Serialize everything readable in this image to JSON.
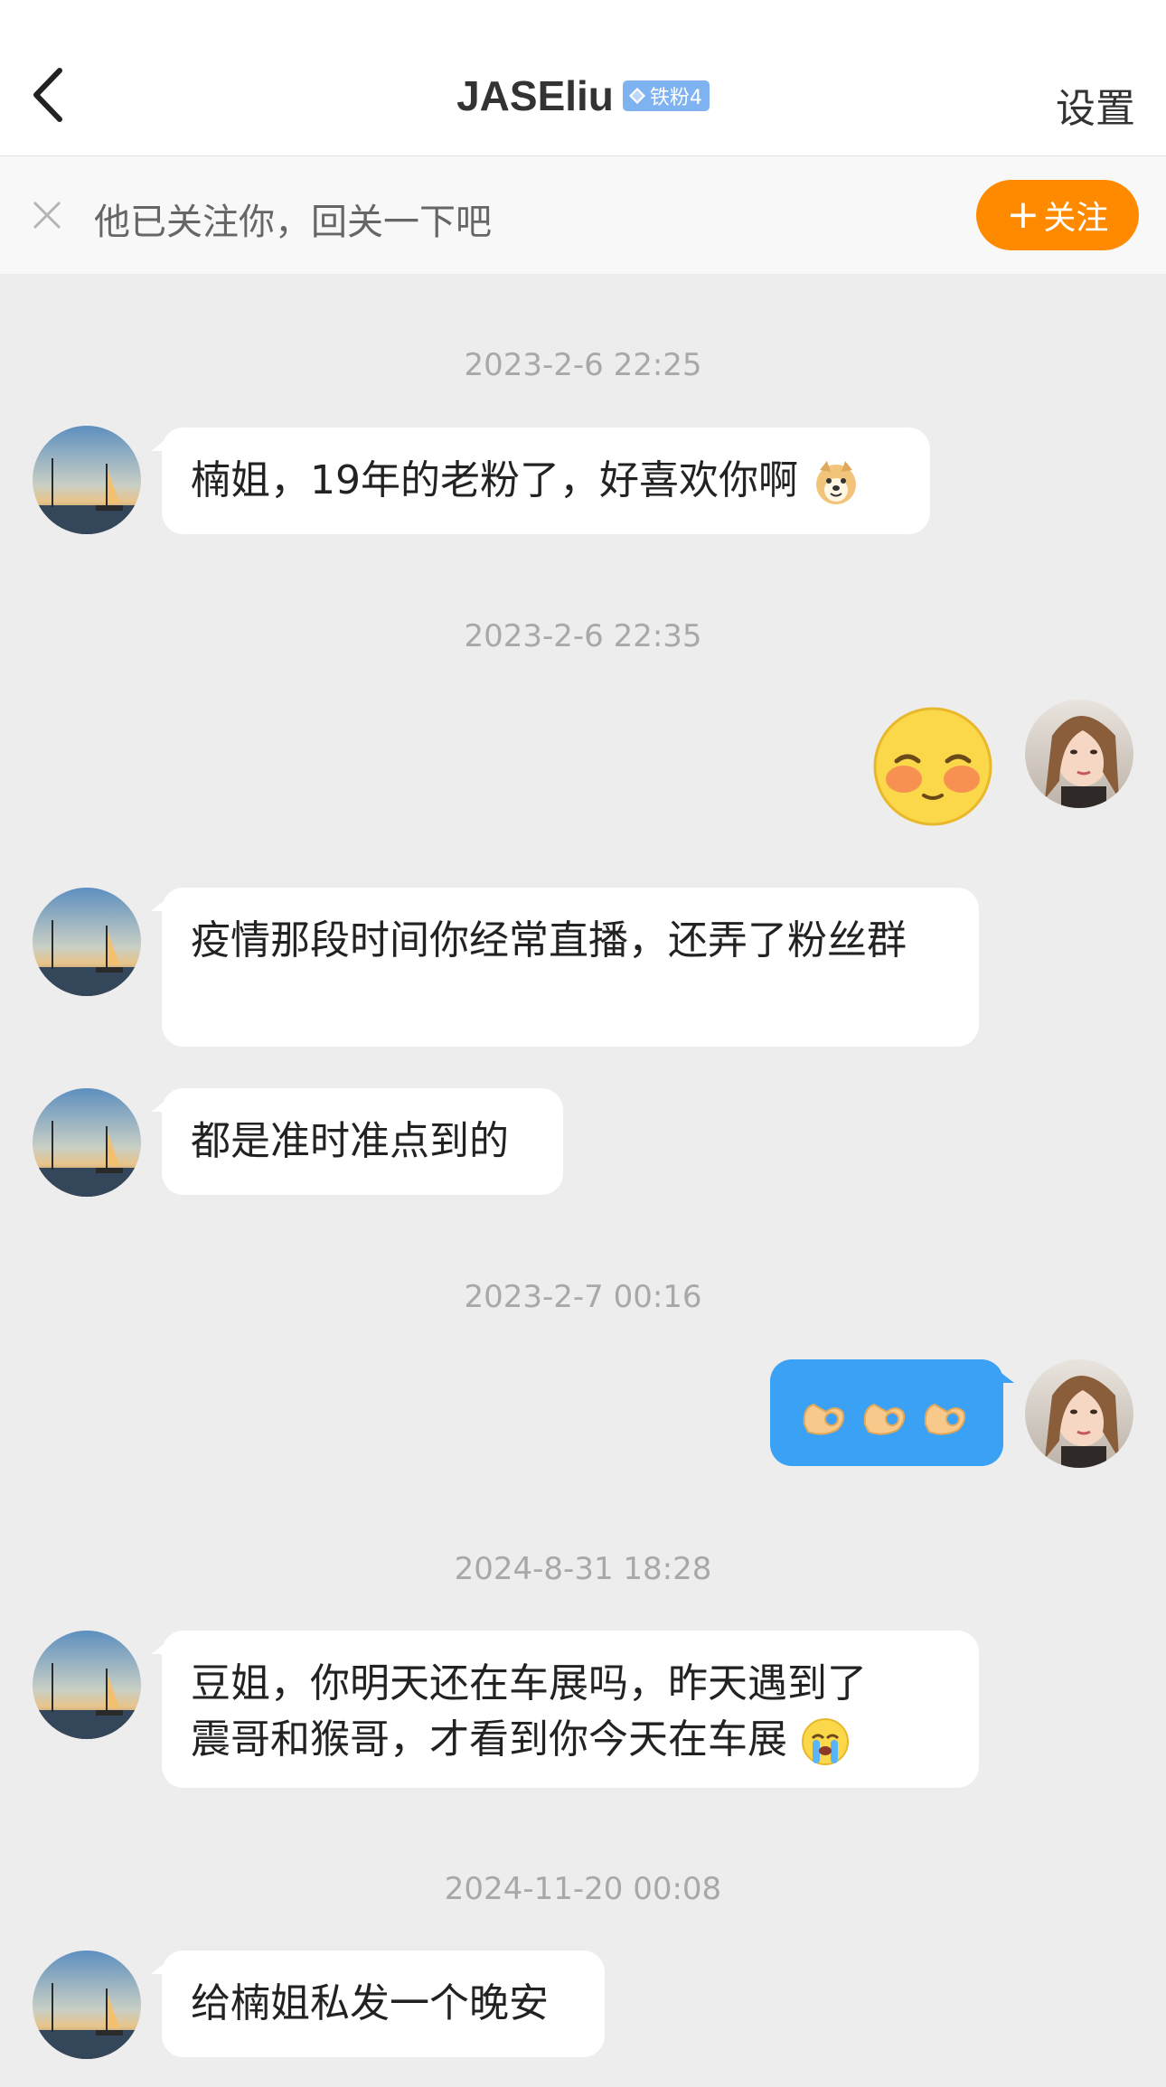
{
  "header": {
    "title": "JASEliu",
    "badge_label": "铁粉4",
    "settings_label": "设置"
  },
  "follow_prompt": {
    "text": "他已关注你，回关一下吧",
    "button_label": "关注"
  },
  "messages": [
    {
      "timestamp": "2023-2-6 22:25",
      "text": "楠姐，19年的老粉了，好喜欢你啊",
      "trailing_emoji": "doge-emoji"
    },
    {
      "timestamp": "2023-2-6 22:35",
      "sticker": "shy-blush-emoji"
    },
    {
      "text": "疫情那段时间你经常直播，还弄了粉丝群"
    },
    {
      "text": "都是准时准点到的"
    },
    {
      "timestamp": "2023-2-7 00:16",
      "emoji": [
        "ok-hand-emoji",
        "ok-hand-emoji",
        "ok-hand-emoji"
      ]
    },
    {
      "timestamp": "2024-8-31 18:28",
      "text_line1": "豆姐，你明天还在车展吗，昨天遇到了",
      "text_line2": "震哥和猴哥，才看到你今天在车展",
      "trailing_emoji": "crying-emoji"
    },
    {
      "timestamp": "2024-11-20 00:08",
      "text": "给楠姐私发一个晚安"
    }
  ],
  "colors": {
    "accent_orange": "#ff8a00",
    "sent_bubble": "#3aa1f5",
    "badge": "#7fb2f0",
    "background": "#ededed"
  }
}
